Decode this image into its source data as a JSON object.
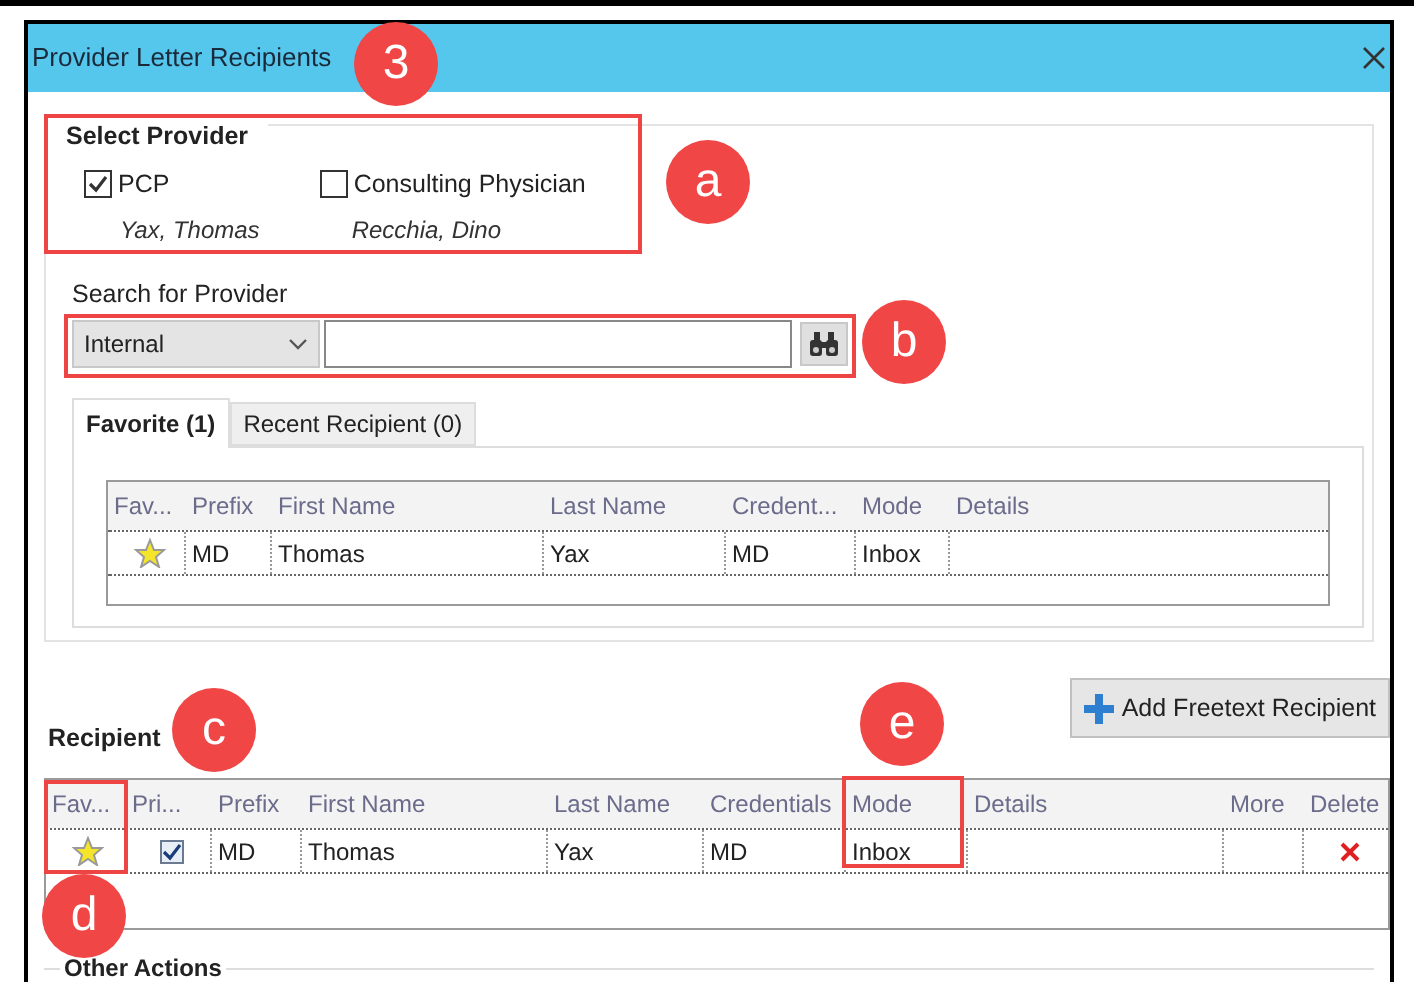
{
  "window": {
    "title": "Provider Letter Recipients"
  },
  "select_provider": {
    "title": "Select Provider",
    "options": [
      {
        "label": "PCP",
        "checked": true,
        "provider": "Yax, Thomas"
      },
      {
        "label": "Consulting Physician",
        "checked": false,
        "provider": "Recchia, Dino"
      }
    ]
  },
  "search": {
    "label": "Search for Provider",
    "scope": "Internal"
  },
  "tabs": [
    {
      "label": "Favorite (1)",
      "selected": true
    },
    {
      "label": "Recent Recipient (0)",
      "selected": false
    }
  ],
  "favorite_table": {
    "columns": [
      "Fav...",
      "Prefix",
      "First Name",
      "Last Name",
      "Credent...",
      "Mode",
      "Details"
    ],
    "rows": [
      {
        "favorite": true,
        "prefix": "MD",
        "first_name": "Thomas",
        "last_name": "Yax",
        "credentials": "MD",
        "mode": "Inbox"
      }
    ]
  },
  "recipient": {
    "title": "Recipient",
    "add_button": "Add Freetext Recipient",
    "columns": [
      "Fav...",
      "Pri...",
      "Prefix",
      "First Name",
      "Last Name",
      "Credentials",
      "Mode",
      "Details",
      "More",
      "Delete"
    ],
    "rows": [
      {
        "favorite": true,
        "primary": true,
        "prefix": "MD",
        "first_name": "Thomas",
        "last_name": "Yax",
        "credentials": "MD",
        "mode": "Inbox"
      }
    ]
  },
  "other_actions": {
    "title": "Other Actions"
  },
  "callouts": [
    {
      "label": "3"
    },
    {
      "label": "a"
    },
    {
      "label": "b"
    },
    {
      "label": "c"
    },
    {
      "label": "e"
    },
    {
      "label": "d"
    }
  ]
}
